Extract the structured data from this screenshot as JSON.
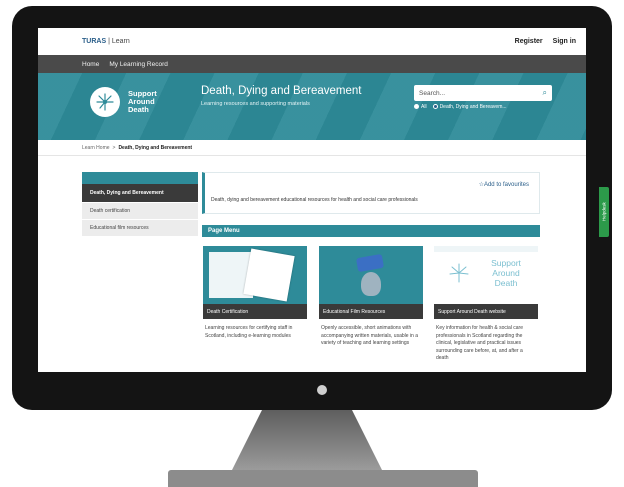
{
  "header": {
    "brand": "TURAS",
    "brand_suffix": "| Learn",
    "register": "Register",
    "sign_in": "Sign in"
  },
  "nav": {
    "items": [
      {
        "label": "Home"
      },
      {
        "label": "My Learning Record"
      }
    ]
  },
  "banner": {
    "logo_lines": [
      "Support",
      "Around",
      "Death"
    ],
    "title": "Death, Dying and Bereavement",
    "subtitle": "Learning resources and supporting materials",
    "search_placeholder": "Search...",
    "radio_all": "All",
    "radio_scope": "Death, Dying and Bereavem..."
  },
  "breadcrumb": {
    "home": "Learn Home",
    "separator": ">",
    "current": "Death, Dying and Bereavement"
  },
  "sidebar": {
    "items": [
      {
        "label": "Death, Dying and Bereavement",
        "active": true
      },
      {
        "label": "Death certification"
      },
      {
        "label": "Educational film resources"
      }
    ]
  },
  "main": {
    "add_favourites": "☆Add to favourites",
    "intro": "Death, dying and bereavement educational resources for health and social care professionals",
    "page_menu": "Page Menu",
    "cards": [
      {
        "label": "Death Certification",
        "desc": "Learning resources for certifying staff in Scotland, including e-learning modules"
      },
      {
        "label": "Educational Film Resources",
        "desc": "Openly accessible, short animations with accompanying written materials, usable in a variety of teaching and learning settings"
      },
      {
        "label": "Support Around Death website",
        "desc": "Key information for health & social care professionals in Scotland regarding the clinical, legislative and practical issues surrounding care before, at, and after a death"
      }
    ],
    "card3_logo": [
      "Support",
      "Around",
      "Death"
    ]
  },
  "feedback": "Helpdesk",
  "colors": {
    "teal": "#2e8b99",
    "dark": "#3a3a3a",
    "bezel": "#141414",
    "feedback": "#2c9a4a"
  }
}
